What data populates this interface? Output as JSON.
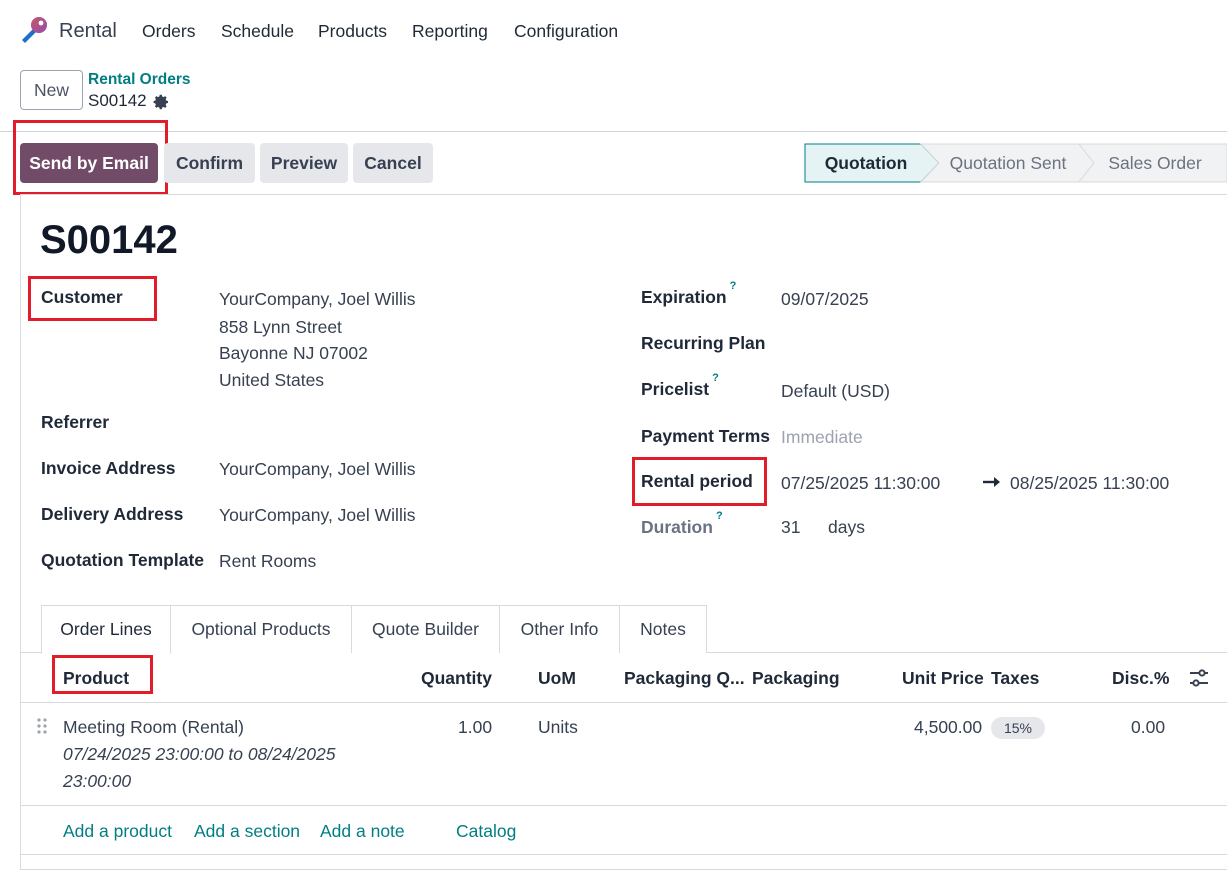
{
  "nav": {
    "app_name": "Rental",
    "menu": [
      "Orders",
      "Schedule",
      "Products",
      "Reporting",
      "Configuration"
    ]
  },
  "control": {
    "new_label": "New",
    "breadcrumb_parent": "Rental Orders",
    "breadcrumb_current": "S00142"
  },
  "actions": {
    "send_email": "Send by Email",
    "confirm": "Confirm",
    "preview": "Preview",
    "cancel": "Cancel"
  },
  "stages": [
    "Quotation",
    "Quotation Sent",
    "Sales Order"
  ],
  "active_stage": "Quotation",
  "form": {
    "title": "S00142",
    "customer_label": "Customer",
    "customer_lines": [
      "YourCompany, Joel Willis",
      "858 Lynn Street",
      "Bayonne NJ 07002",
      "United States"
    ],
    "referrer_label": "Referrer",
    "invoice_label": "Invoice Address",
    "invoice_value": "YourCompany, Joel Willis",
    "delivery_label": "Delivery Address",
    "delivery_value": "YourCompany, Joel Willis",
    "template_label": "Quotation Template",
    "template_value": "Rent Rooms",
    "expiration_label": "Expiration",
    "expiration_value": "09/07/2025",
    "recurring_label": "Recurring Plan",
    "pricelist_label": "Pricelist",
    "pricelist_value": "Default (USD)",
    "payment_label": "Payment Terms",
    "payment_value": "Immediate",
    "rental_label": "Rental period",
    "rental_start": "07/25/2025 11:30:00",
    "rental_end": "08/25/2025 11:30:00",
    "duration_label": "Duration",
    "duration_value": "31",
    "duration_unit": "days",
    "help_mark": "?"
  },
  "tabs": [
    "Order Lines",
    "Optional Products",
    "Quote Builder",
    "Other Info",
    "Notes"
  ],
  "table": {
    "headers": {
      "product": "Product",
      "quantity": "Quantity",
      "uom": "UoM",
      "packaging_qty": "Packaging Q...",
      "packaging": "Packaging",
      "unit_price": "Unit Price",
      "taxes": "Taxes",
      "disc": "Disc.%"
    },
    "rows": [
      {
        "product": "Meeting Room (Rental)",
        "desc_line1": "07/24/2025 23:00:00 to 08/24/2025",
        "desc_line2": "23:00:00",
        "quantity": "1.00",
        "uom": "Units",
        "unit_price": "4,500.00",
        "tax": "15%",
        "disc": "0.00"
      }
    ],
    "add_product": "Add a product",
    "add_section": "Add a section",
    "add_note": "Add a note",
    "catalog": "Catalog"
  },
  "colors": {
    "primary": "#714b67",
    "link": "#017e84",
    "highlight": "#e11d2b"
  }
}
